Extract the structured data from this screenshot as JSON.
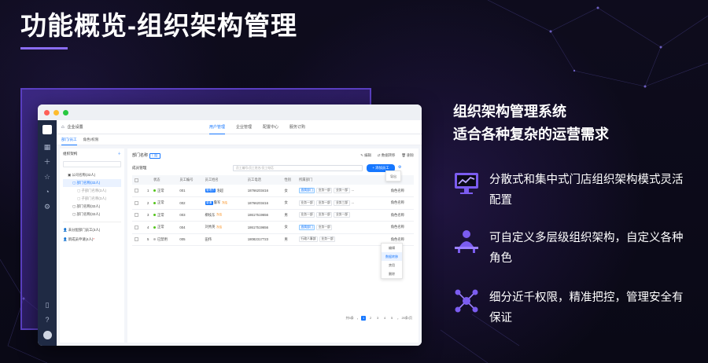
{
  "page_title": "功能概览-组织架构管理",
  "colors": {
    "accent": "#8a6cf0",
    "primary": "#1677ff",
    "rail": "#1f2a44"
  },
  "app": {
    "name": "企业设置",
    "tabs": [
      "用户管理",
      "企业管理",
      "配置中心",
      "服务订购"
    ],
    "subtabs": [
      "部门/员工",
      "角色/权限"
    ],
    "tree": {
      "title": "组织架构",
      "items": [
        {
          "label": "公司名称(32人)",
          "level": "l1"
        },
        {
          "label": "部门名称(32人)",
          "level": "l2",
          "selected": true
        },
        {
          "label": "子部门名称(3人)",
          "level": "l3"
        },
        {
          "label": "子部门名称(3人)",
          "level": "l3"
        },
        {
          "label": "部门名称(32人)",
          "level": "l2"
        },
        {
          "label": "部门名称(32人)",
          "level": "l2"
        }
      ],
      "unassigned": "未分配部门员工(3人)",
      "new_members": "新成员申请(4人)",
      "new_marker": "*"
    },
    "panel": {
      "title": "部门名称",
      "tag": "门店",
      "actions": [
        "编辑",
        "数据转移",
        "删除"
      ],
      "list_label": "成员管理",
      "search_placeholder": "员工编号/员工姓名/员工电话",
      "add_button": "+ 添加员工",
      "export": "导出",
      "columns": [
        "状态",
        "员工编号",
        "员工姓名",
        "员工电话",
        "性别",
        "所属部门",
        "角色"
      ],
      "rows": [
        {
          "idx": "1",
          "status": "正常",
          "on": true,
          "no": "001",
          "badge": "管理员",
          "name": "洛超",
          "phone": "18766203416",
          "gender": "女",
          "depts": [
            "直属部门",
            "业务一部",
            "业务一部"
          ],
          "more": "...",
          "role": "角色名称"
        },
        {
          "idx": "2",
          "status": "正常",
          "on": true,
          "no": "002",
          "badge": "普通",
          "name": "鲁军",
          "tag2": "冻结",
          "phone": "18766203416",
          "gender": "女",
          "depts": [
            "业务一部",
            "业务一部",
            "业务三部"
          ],
          "more": "...",
          "role": "角色名称"
        },
        {
          "idx": "3",
          "status": "正常",
          "on": true,
          "no": "003",
          "name": "柳枝东",
          "tag2": "冻结",
          "phone": "18617519656",
          "gender": "男",
          "depts": [
            "业务一部",
            "业务一部",
            "业务一部"
          ],
          "more": "",
          "role": "角色名称"
        },
        {
          "idx": "4",
          "status": "正常",
          "on": true,
          "no": "004",
          "name": "刘秀英",
          "tag2": "冻结",
          "phone": "18617519656",
          "gender": "女",
          "depts": [
            "直属部门",
            "业务一部"
          ],
          "more": "",
          "role": "角色名称"
        },
        {
          "idx": "5",
          "status": "已禁用",
          "on": false,
          "no": "005",
          "name": "田伟",
          "phone": "18082317723",
          "gender": "男",
          "depts": [
            "行政人事部",
            "业务一部"
          ],
          "more": "",
          "role": "角色名称"
        }
      ],
      "row_menu": [
        "编辑",
        "数据转移",
        "禁用",
        "删除"
      ],
      "pager": {
        "total": "共5条",
        "pages": [
          "1",
          "2",
          "3",
          "4",
          "5"
        ],
        "size": "20条/页"
      }
    }
  },
  "headline": [
    "组织架构管理系统",
    "适合各种复杂的运营需求"
  ],
  "features": [
    {
      "icon": "monitor-chart-icon",
      "text": "分散式和集中式门店组织架构模式灵活配置"
    },
    {
      "icon": "person-at-desk-icon",
      "text": "可自定义多层级组织架构，自定义各种角色"
    },
    {
      "icon": "network-nodes-icon",
      "text": "细分近千权限，精准把控，管理安全有保证"
    }
  ]
}
